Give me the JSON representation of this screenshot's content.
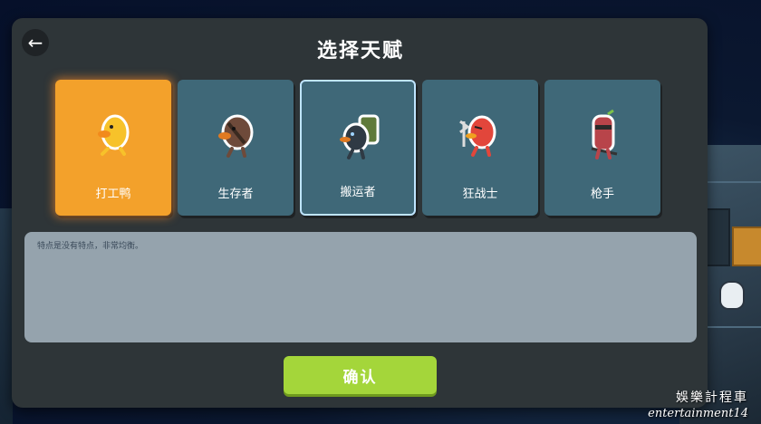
{
  "screen": {
    "title": "选择天赋"
  },
  "back_button": {
    "icon": "arrow-left-icon",
    "glyph": "←"
  },
  "talents": [
    {
      "name": "打工鸭",
      "icon": "worker-duck-icon",
      "state": "selected"
    },
    {
      "name": "生存者",
      "icon": "survivor-duck-icon",
      "state": "normal"
    },
    {
      "name": "搬运者",
      "icon": "porter-duck-icon",
      "state": "highlighted"
    },
    {
      "name": "狂战士",
      "icon": "berserker-duck-icon",
      "state": "normal"
    },
    {
      "name": "枪手",
      "icon": "gunner-duck-icon",
      "state": "normal"
    }
  ],
  "description": {
    "text": "特点是没有特点，非常均衡。"
  },
  "confirm_button": {
    "label": "确认"
  },
  "watermark": {
    "cn": "娛樂計程車",
    "en": "entertainment14"
  },
  "colors": {
    "selected_card": "#f3a12b",
    "card": "#3f6878",
    "confirm": "#a4d63a",
    "panel": "#2e3538"
  }
}
